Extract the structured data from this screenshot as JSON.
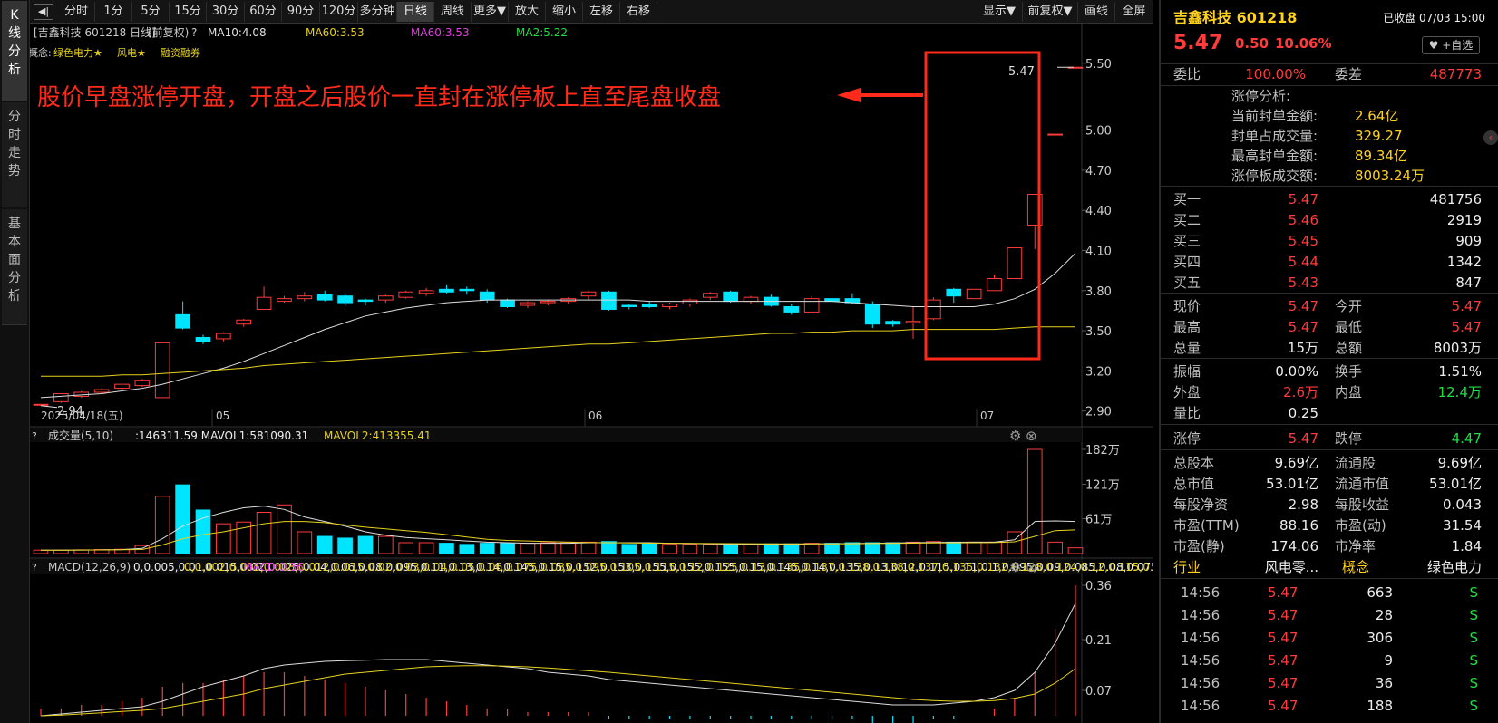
{
  "left_tabs": [
    {
      "label": "K\n线\n分\n析",
      "active": true
    },
    {
      "label": "分\n时\n走\n势",
      "active": false
    },
    {
      "label": "基\n本\n面\n分\n析",
      "active": false
    }
  ],
  "toolbar": {
    "left": [
      "分时",
      "1分",
      "5分",
      "15分",
      "30分",
      "60分",
      "90分",
      "120分",
      "多分钟",
      "日线",
      "周线",
      "更多▼",
      "放大",
      "缩小",
      "左移",
      "右移"
    ],
    "active": "日线",
    "right": [
      "显示▼",
      "前复权▼",
      "画线",
      "全屏"
    ]
  },
  "chart_header": {
    "title": "[吉鑫科技 601218 日线]",
    "fq": "(前复权)",
    "help": "?",
    "ma10": "MA10:4.08",
    "ma60a": "MA60:3.53",
    "ma60b": "MA60:3.53",
    "ma2": "MA2:5.22"
  },
  "concepts": {
    "label": "概念:",
    "items": [
      "绿色电力★",
      "风电★",
      "融资融券"
    ]
  },
  "annotation": "股价早盘涨停开盘，开盘之后股价一直封在涨停板上直至尾盘收盘",
  "colors": {
    "up": "#ff3b3b",
    "down": "#00e5ff",
    "ma_short": "#dddddd",
    "ma_long": "#e6d21e",
    "annotation": "#ff2a1a"
  },
  "chart_data": {
    "type": "candlestick",
    "price_axis": {
      "ticks": [
        "5.50",
        "5.00",
        "4.70",
        "4.40",
        "4.10",
        "3.80",
        "3.50",
        "3.20",
        "2.90"
      ],
      "ylim": [
        2.83,
        5.58
      ]
    },
    "date_labels": [
      "2025/04/18(五)",
      "05",
      "06",
      "07"
    ],
    "high_label": "5.47",
    "low_label": "2.94",
    "candles": [
      [
        2.95,
        2.95,
        2.94,
        2.95
      ],
      [
        2.97,
        3.03,
        2.96,
        3.03
      ],
      [
        3.01,
        3.05,
        3.0,
        3.04
      ],
      [
        3.04,
        3.07,
        3.03,
        3.06
      ],
      [
        3.07,
        3.1,
        3.06,
        3.1
      ],
      [
        3.09,
        3.14,
        3.08,
        3.13
      ],
      [
        3.0,
        3.41,
        3.0,
        3.41
      ],
      [
        3.62,
        3.72,
        3.51,
        3.52
      ],
      [
        3.45,
        3.47,
        3.4,
        3.42
      ],
      [
        3.44,
        3.49,
        3.42,
        3.48
      ],
      [
        3.55,
        3.59,
        3.53,
        3.58
      ],
      [
        3.66,
        3.83,
        3.66,
        3.75
      ],
      [
        3.72,
        3.76,
        3.71,
        3.74
      ],
      [
        3.74,
        3.79,
        3.72,
        3.76
      ],
      [
        3.77,
        3.8,
        3.72,
        3.73
      ],
      [
        3.76,
        3.78,
        3.69,
        3.71
      ],
      [
        3.73,
        3.74,
        3.69,
        3.72
      ],
      [
        3.73,
        3.77,
        3.71,
        3.76
      ],
      [
        3.75,
        3.8,
        3.74,
        3.79
      ],
      [
        3.78,
        3.82,
        3.76,
        3.8
      ],
      [
        3.81,
        3.84,
        3.78,
        3.79
      ],
      [
        3.81,
        3.83,
        3.77,
        3.8
      ],
      [
        3.79,
        3.81,
        3.71,
        3.73
      ],
      [
        3.73,
        3.74,
        3.67,
        3.68
      ],
      [
        3.69,
        3.72,
        3.67,
        3.71
      ],
      [
        3.71,
        3.73,
        3.69,
        3.72
      ],
      [
        3.72,
        3.75,
        3.7,
        3.74
      ],
      [
        3.76,
        3.8,
        3.73,
        3.79
      ],
      [
        3.79,
        3.8,
        3.65,
        3.66
      ],
      [
        3.69,
        3.7,
        3.66,
        3.68
      ],
      [
        3.7,
        3.72,
        3.67,
        3.68
      ],
      [
        3.68,
        3.71,
        3.66,
        3.7
      ],
      [
        3.7,
        3.74,
        3.68,
        3.73
      ],
      [
        3.75,
        3.79,
        3.73,
        3.78
      ],
      [
        3.79,
        3.8,
        3.71,
        3.72
      ],
      [
        3.72,
        3.76,
        3.7,
        3.75
      ],
      [
        3.75,
        3.77,
        3.68,
        3.69
      ],
      [
        3.68,
        3.7,
        3.62,
        3.64
      ],
      [
        3.64,
        3.76,
        3.63,
        3.74
      ],
      [
        3.74,
        3.78,
        3.71,
        3.72
      ],
      [
        3.74,
        3.78,
        3.7,
        3.71
      ],
      [
        3.7,
        3.72,
        3.52,
        3.55
      ],
      [
        3.57,
        3.58,
        3.53,
        3.55
      ],
      [
        3.56,
        3.68,
        3.44,
        3.57
      ],
      [
        3.59,
        3.75,
        3.58,
        3.73
      ],
      [
        3.81,
        3.82,
        3.71,
        3.76
      ],
      [
        3.74,
        3.81,
        3.74,
        3.81
      ],
      [
        3.8,
        3.92,
        3.8,
        3.89
      ],
      [
        3.89,
        4.12,
        3.89,
        4.12
      ],
      [
        4.29,
        4.52,
        4.11,
        4.52
      ],
      [
        4.97,
        4.97,
        4.97,
        4.97
      ],
      [
        5.47,
        5.47,
        5.47,
        5.47
      ]
    ],
    "ma_short": [
      3.0,
      3.01,
      3.02,
      3.03,
      3.05,
      3.07,
      3.1,
      3.14,
      3.18,
      3.22,
      3.27,
      3.33,
      3.39,
      3.45,
      3.51,
      3.56,
      3.61,
      3.64,
      3.67,
      3.69,
      3.71,
      3.72,
      3.73,
      3.73,
      3.73,
      3.73,
      3.73,
      3.73,
      3.73,
      3.73,
      3.72,
      3.72,
      3.72,
      3.72,
      3.72,
      3.72,
      3.72,
      3.72,
      3.72,
      3.72,
      3.71,
      3.7,
      3.69,
      3.68,
      3.68,
      3.68,
      3.68,
      3.7,
      3.74,
      3.81,
      3.93,
      4.08
    ],
    "ma_long": [
      3.16,
      3.16,
      3.16,
      3.16,
      3.17,
      3.17,
      3.18,
      3.19,
      3.2,
      3.21,
      3.22,
      3.24,
      3.25,
      3.26,
      3.27,
      3.28,
      3.29,
      3.3,
      3.31,
      3.32,
      3.33,
      3.34,
      3.35,
      3.36,
      3.37,
      3.38,
      3.39,
      3.4,
      3.4,
      3.41,
      3.42,
      3.43,
      3.44,
      3.45,
      3.46,
      3.47,
      3.48,
      3.48,
      3.49,
      3.49,
      3.5,
      3.5,
      3.5,
      3.51,
      3.51,
      3.51,
      3.51,
      3.51,
      3.52,
      3.53,
      3.53,
      3.53
    ],
    "volume": {
      "header": "成交量(5,10)",
      "stats": ":146311.59 MAVOL1:581090.31",
      "mavol2": "MAVOL2:413355.41",
      "ticks": [
        "182万",
        "121万",
        "61万"
      ],
      "ymax": 1820000,
      "values": [
        60000,
        60000,
        65000,
        70000,
        75000,
        140000,
        1000000,
        1200000,
        760000,
        520000,
        550000,
        720000,
        850000,
        380000,
        300000,
        270000,
        300000,
        300000,
        190000,
        190000,
        180000,
        160000,
        180000,
        180000,
        180000,
        190000,
        200000,
        200000,
        210000,
        160000,
        170000,
        160000,
        160000,
        160000,
        160000,
        160000,
        170000,
        170000,
        180000,
        180000,
        190000,
        190000,
        190000,
        200000,
        210000,
        200000,
        200000,
        200000,
        380000,
        1820000,
        200000,
        100000
      ],
      "ma1": [
        60000,
        60000,
        62000,
        65000,
        70000,
        90000,
        260000,
        480000,
        620000,
        720000,
        800000,
        830000,
        770000,
        640000,
        560000,
        480000,
        380000,
        320000,
        280000,
        260000,
        240000,
        220000,
        200000,
        190000,
        180000,
        180000,
        180000,
        190000,
        190000,
        190000,
        190000,
        180000,
        175000,
        170000,
        165000,
        160000,
        165000,
        165000,
        170000,
        172000,
        175000,
        180000,
        185000,
        190000,
        195000,
        198000,
        200000,
        200000,
        240000,
        560000,
        570000,
        560000
      ],
      "ma2": [
        60000,
        60000,
        62000,
        64000,
        66000,
        72000,
        150000,
        260000,
        330000,
        380000,
        450000,
        520000,
        560000,
        560000,
        540000,
        500000,
        460000,
        430000,
        400000,
        370000,
        330000,
        290000,
        250000,
        230000,
        220000,
        210000,
        200000,
        195000,
        190000,
        185000,
        182000,
        180000,
        178000,
        176000,
        174000,
        172000,
        170000,
        170000,
        170000,
        170000,
        172000,
        175000,
        178000,
        182000,
        185000,
        188000,
        190000,
        192000,
        205000,
        300000,
        400000,
        413000
      ]
    },
    "macd": {
      "header": "MACD(12,26,9)",
      "dif": [
        0.0,
        0.005,
        0.01,
        0.015,
        0.02,
        0.025,
        0.04,
        0.06,
        0.08,
        0.095,
        0.11,
        0.13,
        0.14,
        0.145,
        0.15,
        0.152,
        0.153,
        0.155,
        0.155,
        0.155,
        0.15,
        0.145,
        0.14,
        0.135,
        0.13,
        0.12,
        0.115,
        0.11,
        0.1,
        0.095,
        0.09,
        0.085,
        0.08,
        0.075,
        0.07,
        0.065,
        0.06,
        0.055,
        0.05,
        0.045,
        0.04,
        0.035,
        0.03,
        0.03,
        0.03,
        0.035,
        0.04,
        0.05,
        0.07,
        0.12,
        0.2,
        0.31
      ],
      "dea": [
        0.0,
        0.002,
        0.005,
        0.008,
        0.012,
        0.015,
        0.02,
        0.03,
        0.04,
        0.05,
        0.06,
        0.075,
        0.085,
        0.095,
        0.105,
        0.115,
        0.12,
        0.125,
        0.13,
        0.135,
        0.137,
        0.138,
        0.138,
        0.137,
        0.135,
        0.132,
        0.128,
        0.124,
        0.12,
        0.115,
        0.11,
        0.105,
        0.1,
        0.095,
        0.09,
        0.085,
        0.08,
        0.075,
        0.07,
        0.065,
        0.06,
        0.055,
        0.05,
        0.045,
        0.042,
        0.04,
        0.04,
        0.042,
        0.048,
        0.06,
        0.09,
        0.13
      ],
      "macd": "MACD:0.36",
      "ticks": [
        "0.36",
        "0.21",
        "0.07"
      ],
      "ylim": [
        -0.02,
        0.38
      ],
      "hist": [
        0.02,
        0.02,
        0.03,
        0.03,
        0.04,
        0.05,
        0.08,
        0.09,
        0.09,
        0.1,
        0.11,
        0.12,
        0.12,
        0.11,
        0.1,
        0.09,
        0.08,
        0.07,
        0.06,
        0.05,
        0.04,
        0.03,
        0.02,
        0.02,
        0.01,
        0.01,
        0.01,
        0.01,
        -0.01,
        -0.01,
        -0.01,
        -0.01,
        -0.01,
        -0.01,
        -0.01,
        -0.01,
        -0.01,
        -0.01,
        -0.01,
        -0.01,
        -0.01,
        -0.02,
        -0.02,
        -0.02,
        -0.01,
        -0.01,
        0.0,
        0.02,
        0.05,
        0.12,
        0.24,
        0.36
      ]
    }
  },
  "stock": {
    "name": "吉鑫科技 601218",
    "status": "已收盘 07/03 15:00",
    "price": "5.47",
    "change": "0.50",
    "pct": "10.06%",
    "fav": "+自选"
  },
  "weibi": {
    "l1": "委比",
    "v1": "100.00%",
    "l2": "委差",
    "v2": "487773"
  },
  "zt": {
    "title": "涨停分析:",
    "rows": [
      {
        "label": "当前封单金额:",
        "value": "2.64亿"
      },
      {
        "label": "封单占成交量:",
        "value": "329.27"
      },
      {
        "label": "最高封单金额:",
        "value": "89.34亿"
      },
      {
        "label": "涨停板成交额:",
        "value": "8003.24万"
      }
    ]
  },
  "bids": [
    {
      "label": "买一",
      "price": "5.47",
      "vol": "481756"
    },
    {
      "label": "买二",
      "price": "5.46",
      "vol": "2919"
    },
    {
      "label": "买三",
      "price": "5.45",
      "vol": "909"
    },
    {
      "label": "买四",
      "price": "5.44",
      "vol": "1342"
    },
    {
      "label": "买五",
      "price": "5.43",
      "vol": "847"
    }
  ],
  "quote": [
    {
      "l1": "现价",
      "v1": "5.47",
      "c1": "red",
      "l2": "今开",
      "v2": "5.47",
      "c2": "red"
    },
    {
      "l1": "最高",
      "v1": "5.47",
      "c1": "red",
      "l2": "最低",
      "v2": "5.47",
      "c2": "red"
    },
    {
      "l1": "总量",
      "v1": "15万",
      "c1": "white",
      "l2": "总额",
      "v2": "8003万",
      "c2": "white"
    }
  ],
  "stats": [
    {
      "l1": "振幅",
      "v1": "0.00%",
      "c1": "white",
      "l2": "换手",
      "v2": "1.51%",
      "c2": "white"
    },
    {
      "l1": "外盘",
      "v1": "2.6万",
      "c1": "red",
      "l2": "内盘",
      "v2": "12.4万",
      "c2": "green"
    },
    {
      "l1": "量比",
      "v1": "0.25",
      "c1": "white",
      "l2": "",
      "v2": "",
      "c2": "white"
    }
  ],
  "limits": {
    "l1": "涨停",
    "v1": "5.47",
    "l2": "跌停",
    "v2": "4.47"
  },
  "fund": [
    {
      "l1": "总股本",
      "v1": "9.69亿",
      "l2": "流通股",
      "v2": "9.69亿"
    },
    {
      "l1": "总市值",
      "v1": "53.01亿",
      "l2": "流通市值",
      "v2": "53.01亿"
    },
    {
      "l1": "每股净资",
      "v1": "2.98",
      "l2": "每股收益",
      "v2": "0.043"
    },
    {
      "l1": "市盈(TTM)",
      "v1": "88.16",
      "l2": "市盈(动)",
      "v2": "31.54"
    },
    {
      "l1": "市盈(静)",
      "v1": "174.06",
      "l2": "市净率",
      "v2": "1.84"
    }
  ],
  "industry": {
    "l1": "行业",
    "v1": "风电零...",
    "l2": "概念",
    "v2": "绿色电力"
  },
  "ticks": [
    {
      "time": "14:56",
      "price": "5.47",
      "vol": "663",
      "side": "S"
    },
    {
      "time": "14:56",
      "price": "5.47",
      "vol": "28",
      "side": "S"
    },
    {
      "time": "14:56",
      "price": "5.47",
      "vol": "306",
      "side": "S"
    },
    {
      "time": "14:56",
      "price": "5.47",
      "vol": "9",
      "side": "S"
    },
    {
      "time": "14:56",
      "price": "5.47",
      "vol": "36",
      "side": "S"
    },
    {
      "time": "14:56",
      "price": "5.47",
      "vol": "188",
      "side": "S"
    }
  ]
}
